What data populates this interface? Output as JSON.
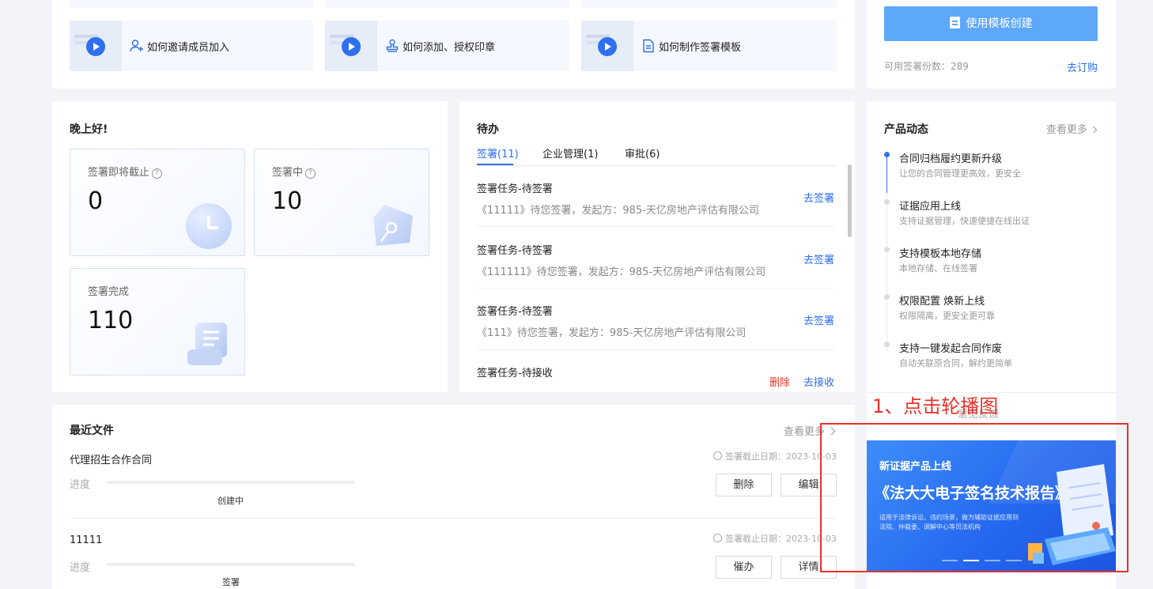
{
  "videos": [
    {
      "label": "如何邀请成员加入",
      "icon": "add-user-icon"
    },
    {
      "label": "如何添加、授权印章",
      "icon": "stamp-icon"
    },
    {
      "label": "如何制作签署模板",
      "icon": "document-icon"
    }
  ],
  "template": {
    "button_label": "使用模板创建",
    "quota_label": "可用签署份数：289",
    "subscribe_label": "去订购"
  },
  "greeting": {
    "title": "晚上好!",
    "stats": [
      {
        "label": "签署即将截止",
        "value": "0",
        "icon": "clock-icon"
      },
      {
        "label": "签署中",
        "value": "10",
        "icon": "pen-icon"
      },
      {
        "label": "签署完成",
        "value": "110",
        "icon": "scroll-icon"
      }
    ]
  },
  "todo": {
    "title": "待办",
    "tabs": [
      {
        "label": "签署(11)",
        "active": true
      },
      {
        "label": "企业管理(1)",
        "active": false
      },
      {
        "label": "审批(6)",
        "active": false
      }
    ],
    "items": [
      {
        "title": "签署任务-待签署",
        "desc": "《11111》待您签署，发起方：985-天亿房地产评估有限公司",
        "action": "去签署"
      },
      {
        "title": "签署任务-待签署",
        "desc": "《111111》待您签署，发起方：985-天亿房地产评估有限公司",
        "action": "去签署"
      },
      {
        "title": "签署任务-待签署",
        "desc": "《111》待您签署，发起方：985-天亿房地产评估有限公司",
        "action": "去签署"
      },
      {
        "title": "签署任务-待接收",
        "desc": "",
        "action": "去接收",
        "extra_action": "删除"
      }
    ]
  },
  "news": {
    "title": "产品动态",
    "more": "查看更多",
    "items": [
      {
        "title": "合同归档履约更新升级",
        "desc": "让您的合同管理更高效，更安全"
      },
      {
        "title": "证据应用上线",
        "desc": "支持证据管理，快速便捷在线出证"
      },
      {
        "title": "支持模板本地存储",
        "desc": "本地存储、在线签署"
      },
      {
        "title": "权限配置 焕新上线",
        "desc": "权限隔离，更安全更可靠"
      },
      {
        "title": "支持一键发起合同作废",
        "desc": "自动关联原合同，解约更简单"
      }
    ]
  },
  "annotation": {
    "label": "1、点击轮播图",
    "overlapped_text": "意见反馈"
  },
  "banner": {
    "kicker": "新证据产品上线",
    "title": "《法大大电子签名技术报告》",
    "desc_line1": "适用于法律诉讼、违约场景，做为辅助证据应用到",
    "desc_line2": "法院、仲裁委、调解中心等司法机构",
    "dots": 4,
    "active_dot": 1
  },
  "recent": {
    "title": "最近文件",
    "more": "查看更多",
    "progress_label": "进度",
    "deadline_label": "签署截止日期：2023-10-03",
    "files": [
      {
        "name": "代理招生合作合同",
        "status": "创建中",
        "progress": 0,
        "buttons": [
          "删除",
          "编辑"
        ]
      },
      {
        "name": "11111",
        "status": "签署",
        "progress": 0,
        "buttons": [
          "催办",
          "详情"
        ]
      }
    ]
  },
  "colors": {
    "accent": "#2f6ff0",
    "button_blue": "#5ea8fb",
    "annotation_red": "#e8322b"
  }
}
